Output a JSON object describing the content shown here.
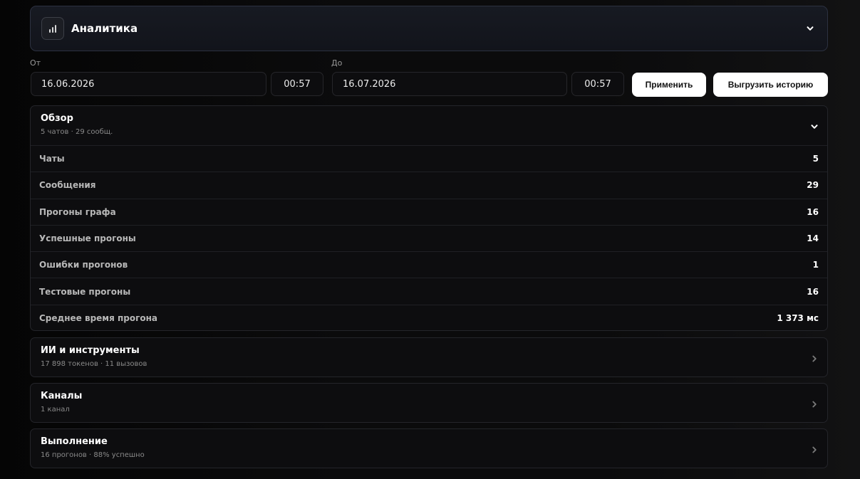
{
  "header": {
    "title": "Аналитика",
    "icon": "bar-chart-icon"
  },
  "filters": {
    "from_label": "От",
    "from_date": "16.06.2026",
    "from_time": "00:57",
    "to_label": "До",
    "to_date": "16.07.2026",
    "to_time": "00:57",
    "apply_label": "Применить",
    "export_label": "Выгрузить историю"
  },
  "overview": {
    "title": "Обзор",
    "subtitle": "5 чатов · 29 сообщ.",
    "rows": [
      {
        "label": "Чаты",
        "value": "5"
      },
      {
        "label": "Сообщения",
        "value": "29"
      },
      {
        "label": "Прогоны графа",
        "value": "16"
      },
      {
        "label": "Успешные прогоны",
        "value": "14"
      },
      {
        "label": "Ошибки прогонов",
        "value": "1"
      },
      {
        "label": "Тестовые прогоны",
        "value": "16"
      },
      {
        "label": "Среднее время прогона",
        "value": "1 373 мс"
      }
    ]
  },
  "sections": [
    {
      "title": "ИИ и инструменты",
      "subtitle": "17 898 токенов · 11 вызовов"
    },
    {
      "title": "Каналы",
      "subtitle": "1 канал"
    },
    {
      "title": "Выполнение",
      "subtitle": "16 прогонов · 88% успешно"
    }
  ]
}
